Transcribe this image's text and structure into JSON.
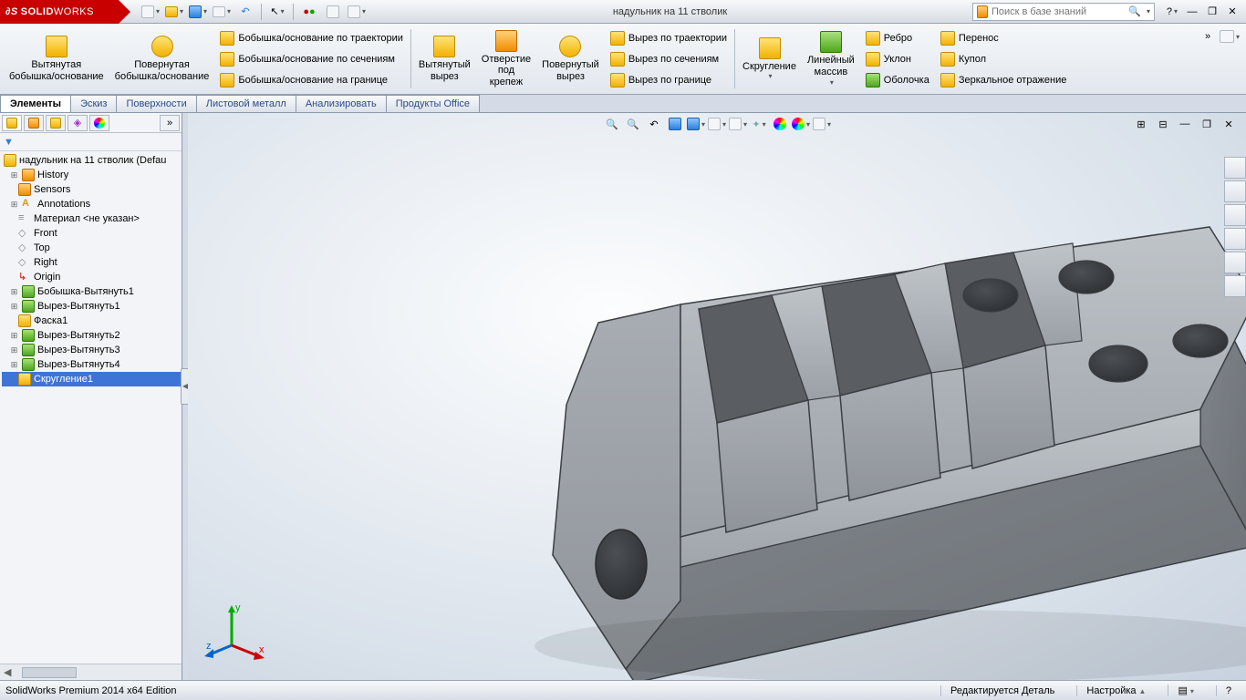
{
  "app": {
    "brand_prefix": "S",
    "brand_mid": "SOLID",
    "brand_suffix": "WORKS"
  },
  "title": "надульник  на 11 стволик",
  "search": {
    "placeholder": "Поиск в базе знаний"
  },
  "ribbon": {
    "extrude_boss": "Вытянутая\nбобышка/основание",
    "revolve_boss": "Повернутая\nбобышка/основание",
    "sweep_boss": "Бобышка/основание по траектории",
    "loft_boss": "Бобышка/основание по сечениям",
    "boundary_boss": "Бобышка/основание на границе",
    "extrude_cut": "Вытянутый\nвырез",
    "hole": "Отверстие\nпод\nкрепеж",
    "revolve_cut": "Повернутый\nвырез",
    "sweep_cut": "Вырез по траектории",
    "loft_cut": "Вырез по сечениям",
    "boundary_cut": "Вырез по границе",
    "fillet": "Скругление",
    "pattern": "Линейный\nмассив",
    "rib": "Ребро",
    "draft": "Уклон",
    "shell": "Оболочка",
    "wrap": "Перенос",
    "dome": "Купол",
    "mirror": "Зеркальное отражение"
  },
  "tabs": [
    "Элементы",
    "Эскиз",
    "Поверхности",
    "Листовой металл",
    "Анализировать",
    "Продукты Office"
  ],
  "tree": {
    "root": "надульник  на 11 стволик  (Defau",
    "nodes": [
      "History",
      "Sensors",
      "Annotations",
      "Материал <не указан>",
      "Front",
      "Top",
      "Right",
      "Origin",
      "Бобышка-Вытянуть1",
      "Вырез-Вытянуть1",
      "Фаска1",
      "Вырез-Вытянуть2",
      "Вырез-Вытянуть3",
      "Вырез-Вытянуть4",
      "Скругление1"
    ]
  },
  "status": {
    "edition": "SolidWorks Premium 2014 x64 Edition",
    "mode": "Редактируется Деталь",
    "settings": "Настройка"
  },
  "triad": {
    "x": "x",
    "y": "y",
    "z": "z"
  }
}
